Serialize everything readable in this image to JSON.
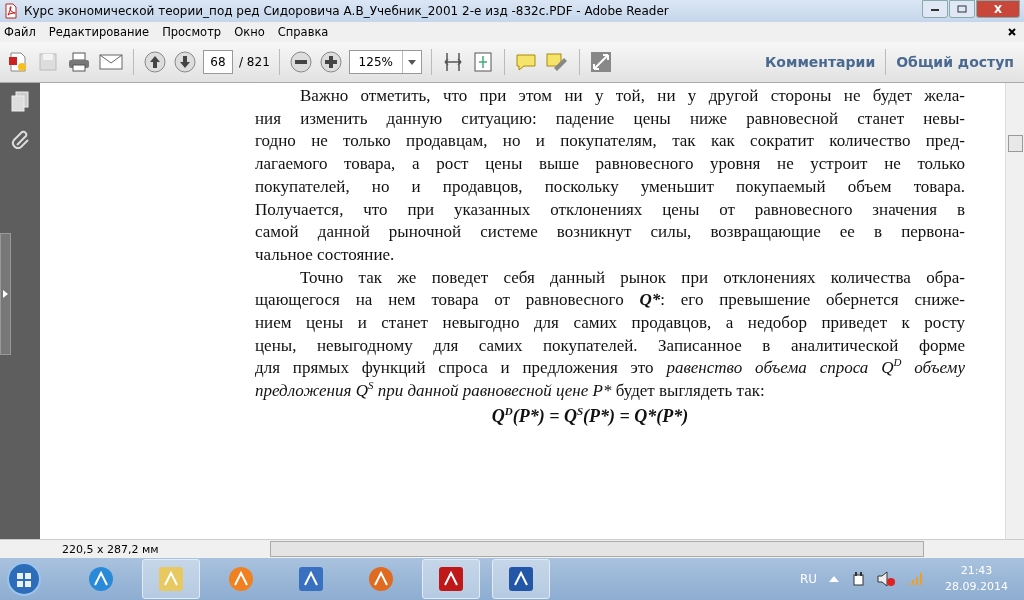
{
  "window": {
    "title": "Курс экономической теории_под ред Сидоровича А.В_Учебник_2001 2-е изд -832с.PDF - Adobe Reader"
  },
  "menu": [
    "Файл",
    "Редактирование",
    "Просмотр",
    "Окно",
    "Справка"
  ],
  "toolbar": {
    "page": "68",
    "page_total": "/ 821",
    "zoom": "125%",
    "links": [
      "Комментарии",
      "Общий доступ"
    ]
  },
  "document": {
    "paragraphs": [
      {
        "lines": [
          "Важно отметить, что при этом ни у той, ни у другой стороны не будет жела-",
          "ния изменить данную ситуацию: падение цены ниже равновесной станет невы-",
          "годно не только продавцам, но и покупателям, так как сократит количество пред-",
          "лагаемого товара, а рост цены выше равновесного уровня не устроит не только",
          "покупателей, но и продавцов, поскольку уменьшит покупаемый объем товара.",
          "Получается, что при указанных отклонениях цены от равновесного значения в",
          "самой данной рыночной системе возникнут силы, возвращающие ее в первона-",
          "чальное состояние."
        ]
      },
      {
        "lines": [
          "Точно так же поведет себя данный рынок при отклонениях количества обра-",
          [
            {
              "kind": "plain",
              "text": "щающегося на нем товара от равновесного "
            },
            {
              "kind": "bolditalic",
              "text": "Q*"
            },
            {
              "kind": "plain",
              "text": ":  его превышение обернется сниже-"
            }
          ],
          "нием цены и станет невыгодно для самих продавцов, а недобор приведет к росту",
          "цены, невыгодному для самих покупателей. Записанное в аналитической форме",
          [
            {
              "kind": "plain",
              "text": "для прямых функций спроса и предложения это "
            },
            {
              "kind": "italic",
              "text": "равенство объема спроса Q"
            },
            {
              "kind": "sup",
              "text": "D"
            },
            {
              "kind": "italic",
              "text": " объему"
            }
          ],
          [
            {
              "kind": "italic",
              "text": "предложения Q"
            },
            {
              "kind": "sup",
              "text": "S"
            },
            {
              "kind": "italic",
              "text": " при данной равновесной цене P*"
            },
            {
              "kind": "plain",
              "text": " будет выглядеть так:"
            }
          ]
        ]
      }
    ],
    "formula": [
      {
        "kind": "italic",
        "text": "Q"
      },
      {
        "kind": "sup",
        "text": "D"
      },
      {
        "kind": "italic",
        "text": "(P*) = Q"
      },
      {
        "kind": "sup",
        "text": "S"
      },
      {
        "kind": "italic",
        "text": "(P*) = Q*(P*)"
      }
    ]
  },
  "status_bar": {
    "page_size": "220,5 x 287,2 мм"
  },
  "taskbar": {
    "apps": [
      {
        "kind": "ie",
        "selected": false
      },
      {
        "kind": "explorer",
        "selected": true
      },
      {
        "kind": "player",
        "selected": false
      },
      {
        "kind": "tool",
        "selected": false
      },
      {
        "kind": "firefox",
        "selected": false
      },
      {
        "kind": "pdf",
        "selected": true
      },
      {
        "kind": "word",
        "selected": true
      }
    ],
    "language": "RU",
    "time": "21:43",
    "date": "28.09.2014"
  }
}
